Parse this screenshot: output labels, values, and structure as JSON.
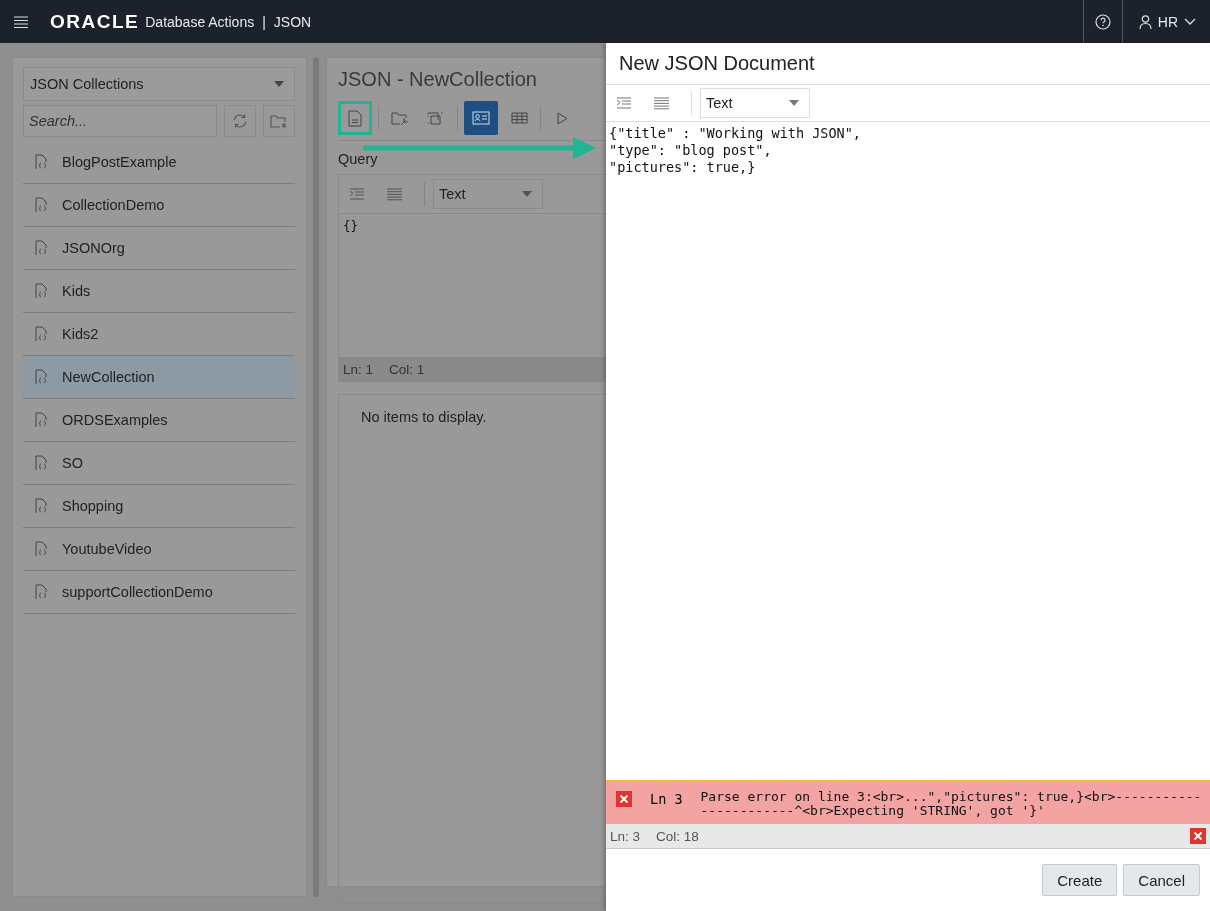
{
  "header": {
    "logo": "ORACLE",
    "product": "Database Actions",
    "separator": "|",
    "section": "JSON",
    "user": "HR"
  },
  "sidebar": {
    "dropdown": "JSON Collections",
    "search": {
      "placeholder": "Search..."
    },
    "items": [
      {
        "label": "BlogPostExample",
        "selected": false
      },
      {
        "label": "CollectionDemo",
        "selected": false
      },
      {
        "label": "JSONOrg",
        "selected": false
      },
      {
        "label": "Kids",
        "selected": false
      },
      {
        "label": "Kids2",
        "selected": false
      },
      {
        "label": "NewCollection",
        "selected": true
      },
      {
        "label": "ORDSExamples",
        "selected": false
      },
      {
        "label": "SO",
        "selected": false
      },
      {
        "label": "Shopping",
        "selected": false
      },
      {
        "label": "YoutubeVideo",
        "selected": false
      },
      {
        "label": "supportCollectionDemo",
        "selected": false
      }
    ]
  },
  "main": {
    "title": "JSON - NewCollection",
    "toolbar": [
      {
        "kind": "new-document",
        "highlighted": true,
        "selected": false
      },
      {
        "kind": "folder-wrench",
        "highlighted": false,
        "selected": false
      },
      {
        "kind": "frame",
        "highlighted": false,
        "selected": false
      },
      {
        "kind": "card-view",
        "highlighted": false,
        "selected": true
      },
      {
        "kind": "table-view",
        "highlighted": false,
        "selected": false
      },
      {
        "kind": "run",
        "highlighted": false,
        "selected": false
      }
    ],
    "query_label": "Query",
    "format": "Text",
    "query": "{}",
    "status": {
      "line": "Ln: 1",
      "col": "Col: 1"
    },
    "results": "No items to display."
  },
  "dialog": {
    "title": "New JSON Document",
    "format": "Text",
    "code": [
      "{\"title\" : \"Working with JSON\",",
      "\"type\": \"blog post\",",
      "\"pictures\": true,}"
    ],
    "error": {
      "line": "Ln 3",
      "message": "Parse error on line 3:<br>...\",\"pictures\": true,}<br>-----------------------^<br>Expecting 'STRING', got '}'"
    },
    "status": {
      "line": "Ln: 3",
      "col": "Col: 18"
    },
    "buttons": [
      "Create",
      "Cancel"
    ]
  }
}
